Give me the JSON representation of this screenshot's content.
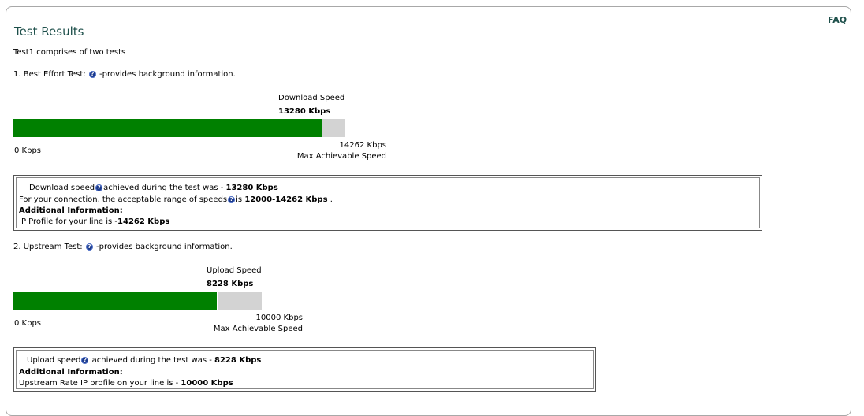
{
  "header": {
    "title": "Test Results",
    "faq_label": "FAQ"
  },
  "intro": "Test1 comprises of two tests",
  "download_test": {
    "heading_prefix": "1. Best Effort Test:",
    "heading_suffix": "-provides background information.",
    "speed_label": "Download Speed",
    "speed_value": "13280 Kbps",
    "min_label": "0 Kbps",
    "max_value": "14262 Kbps",
    "max_label": "Max Achievable Speed",
    "fill_fraction": 0.931,
    "info": {
      "line1_prefix": "Download speed",
      "line1_middle": "achieved during the test was - ",
      "line1_value": "13280 Kbps",
      "line2_prefix": "For your connection, the acceptable range of speeds",
      "line2_middle": "is ",
      "line2_value": "12000-14262 Kbps",
      "line2_suffix": " .",
      "additional_label": "Additional Information:",
      "line4_prefix": "IP Profile for your line is -",
      "line4_value": "14262 Kbps"
    }
  },
  "upload_test": {
    "heading_prefix": "2. Upstream Test:",
    "heading_suffix": "-provides background information.",
    "speed_label": "Upload Speed",
    "speed_value": "8228 Kbps",
    "min_label": "0 Kbps",
    "max_value": "10000 Kbps",
    "max_label": "Max Achievable Speed",
    "fill_fraction": 0.8228,
    "info": {
      "line1_prefix": "Upload speed",
      "line1_middle": " achieved during the test was - ",
      "line1_value": "8228 Kbps",
      "additional_label": "Additional Information:",
      "line3_prefix": "Upstream Rate IP profile on your line is - ",
      "line3_value": "10000 Kbps"
    }
  },
  "colors": {
    "bar_fill": "#008000",
    "bar_track": "#d3d3d3",
    "title": "#1d4f4a",
    "help_icon": "#1b3a8c"
  },
  "icons": {
    "help": "question-circle-icon"
  }
}
